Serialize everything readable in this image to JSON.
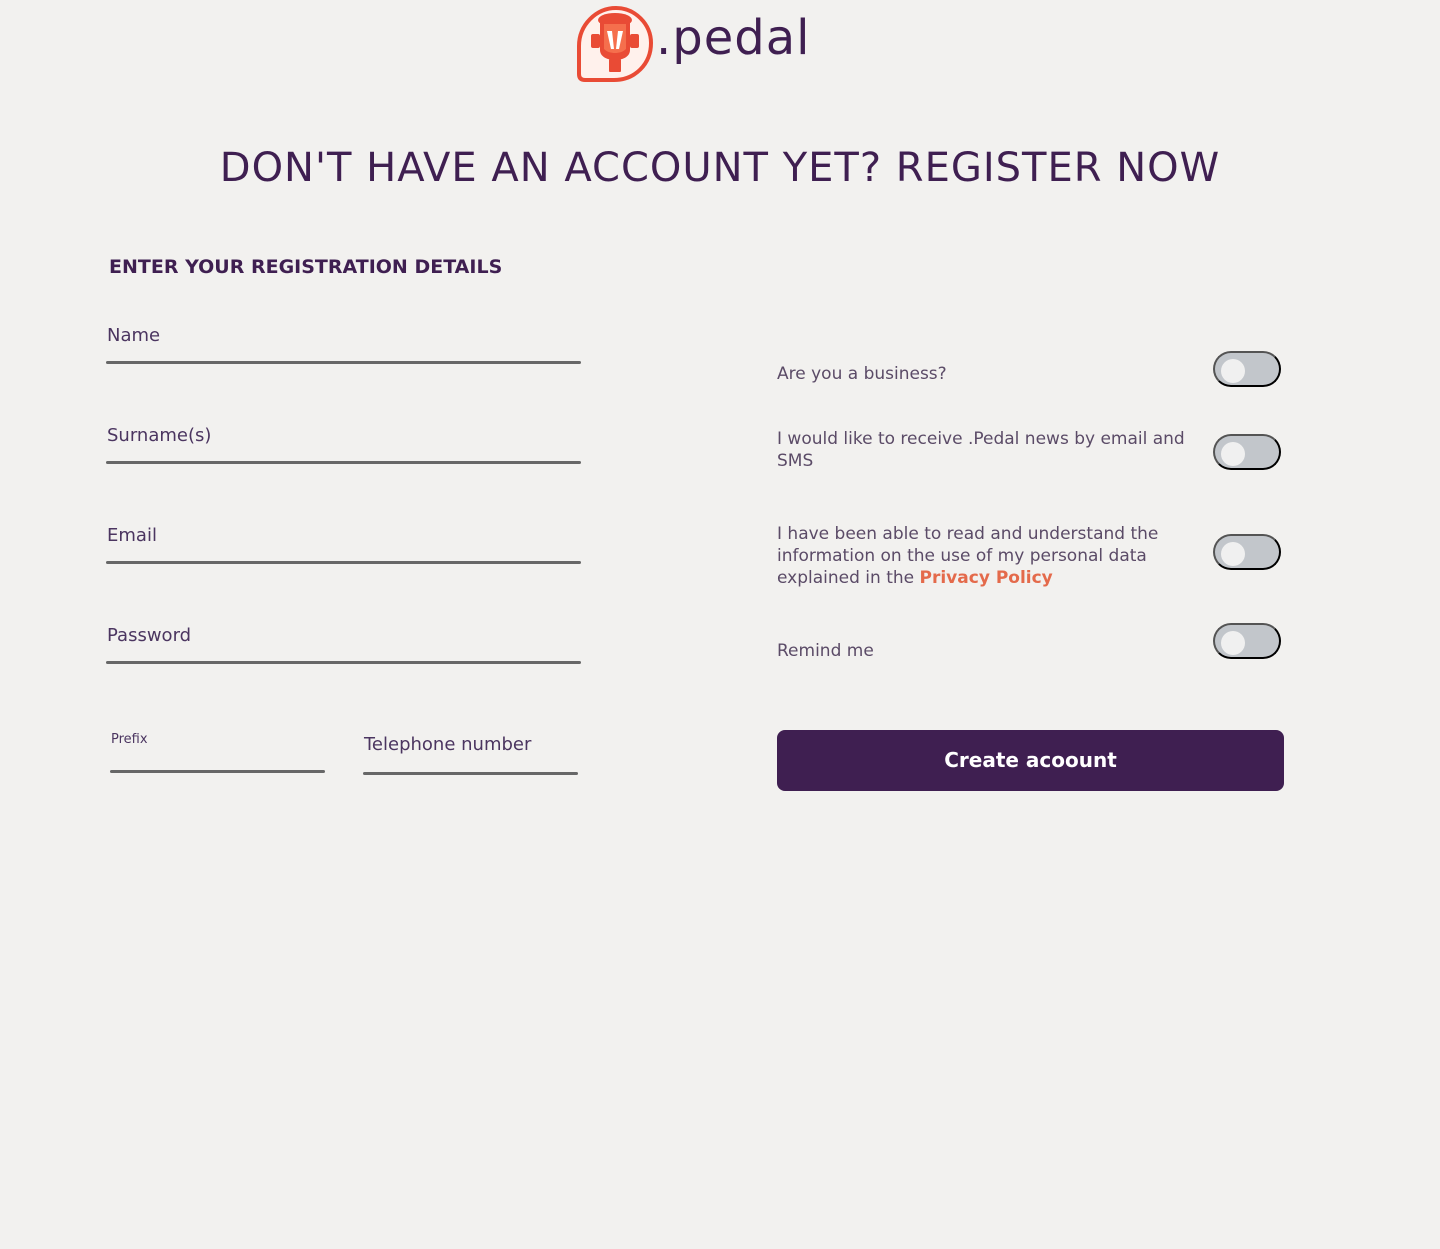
{
  "brand": {
    "name": ".pedal",
    "logo_icon": "pedal-logo-icon",
    "accent_color": "#e94b35",
    "primary_color": "#3f1f51"
  },
  "page": {
    "title": "DON'T HAVE AN ACCOUNT YET? REGISTER NOW",
    "section_title": "ENTER YOUR REGISTRATION DETAILS"
  },
  "form": {
    "name": {
      "label": "Name",
      "value": ""
    },
    "surname": {
      "label": "Surname(s)",
      "value": ""
    },
    "email": {
      "label": "Email",
      "value": ""
    },
    "password": {
      "label": "Password",
      "value": ""
    },
    "prefix": {
      "label": "Prefix",
      "value": ""
    },
    "telephone": {
      "label": "Telephone number",
      "value": ""
    }
  },
  "options": {
    "business": {
      "label": "Are you a business?",
      "checked": false
    },
    "newsletter": {
      "label": "I would like to receive .Pedal news by email and SMS",
      "checked": false
    },
    "privacy": {
      "label_prefix": "I have been able to read and understand the information on the use of my personal data explained in the ",
      "link_text": "Privacy Policy",
      "checked": false
    },
    "remind": {
      "label": "Remind me",
      "checked": false
    }
  },
  "actions": {
    "create_account": "Create acoount"
  }
}
